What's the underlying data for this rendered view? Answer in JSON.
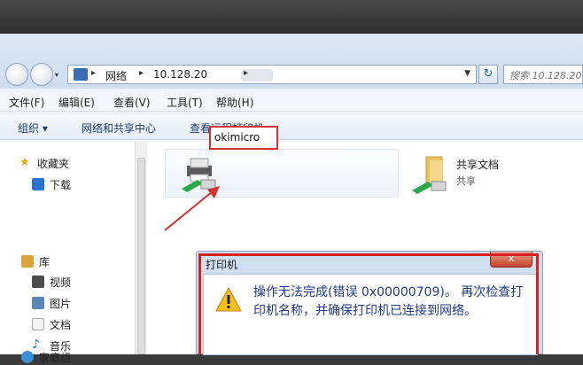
{
  "address": {
    "crumbs": [
      "网络",
      "10.128.20"
    ],
    "search_placeholder": "搜索 10.128.20"
  },
  "menu": [
    "文件(F)",
    "编辑(E)",
    "查看(V)",
    "工具(T)",
    "帮助(H)"
  ],
  "toolbar": {
    "organize": "组织 ▾",
    "network_center": "网络和共享中心",
    "view_remote_printers": "查看远程打印机"
  },
  "sidebar": {
    "favorites": "收藏夹",
    "downloads": "下载",
    "library": "库",
    "videos": "视频",
    "pictures": "图片",
    "documents": "文档",
    "music": "音乐",
    "homegroup": "家庭组"
  },
  "content": {
    "printer_name": "okimicro",
    "share_name": "共享文档",
    "share_sub": "共享"
  },
  "dialog": {
    "title": "打印机",
    "close": "x",
    "message": "操作无法完成(错误 0x00000709)。 再次检查打印机名称，并确保打印机已连接到网络。"
  },
  "colors": {
    "highlight_red": "#d62020",
    "message_blue": "#1f3a86"
  }
}
